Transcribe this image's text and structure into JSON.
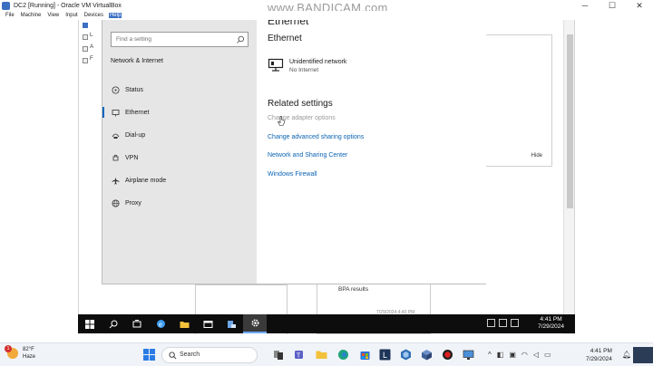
{
  "host": {
    "window_title": "DC2 [Running] - Oracle VM VirtualBox",
    "menu": [
      "File",
      "Machine",
      "View",
      "Input",
      "Devices",
      "Help"
    ],
    "watermark": "www.BANDICAM.com",
    "controls": {
      "minimize": "─",
      "maximize": "☐",
      "close": "✕"
    }
  },
  "background": {
    "stubs": [
      "L",
      "A",
      "F"
    ],
    "hide_label": "Hide",
    "bpa_label": "BPA results",
    "stamp": "7/29/2024 4:40 PM"
  },
  "settings": {
    "cut_title": "Ethernet",
    "search_placeholder": "Find a setting",
    "side_heading": "Network & Internet",
    "nav": [
      {
        "label": "Status",
        "icon": "home-network-icon"
      },
      {
        "label": "Ethernet",
        "icon": "ethernet-icon"
      },
      {
        "label": "Dial-up",
        "icon": "dialup-icon"
      },
      {
        "label": "VPN",
        "icon": "vpn-icon"
      },
      {
        "label": "Airplane mode",
        "icon": "airplane-icon"
      },
      {
        "label": "Proxy",
        "icon": "globe-icon"
      }
    ],
    "main_title": "Ethernet",
    "network": {
      "name": "Unidentified network",
      "status": "No Internet"
    },
    "related_heading": "Related settings",
    "links": [
      "Change adapter options",
      "Change advanced sharing options",
      "Network and Sharing Center",
      "Windows Firewall"
    ],
    "accent_color": "#0a63b3"
  },
  "guest_taskbar": {
    "time": "4:41 PM",
    "date": "7/29/2024"
  },
  "host_taskbar": {
    "weather_temp": "82°F",
    "weather_desc": "Haze",
    "weather_badge": "1",
    "search_label": "Search",
    "time": "4:41 PM",
    "date": "7/29/2024"
  }
}
